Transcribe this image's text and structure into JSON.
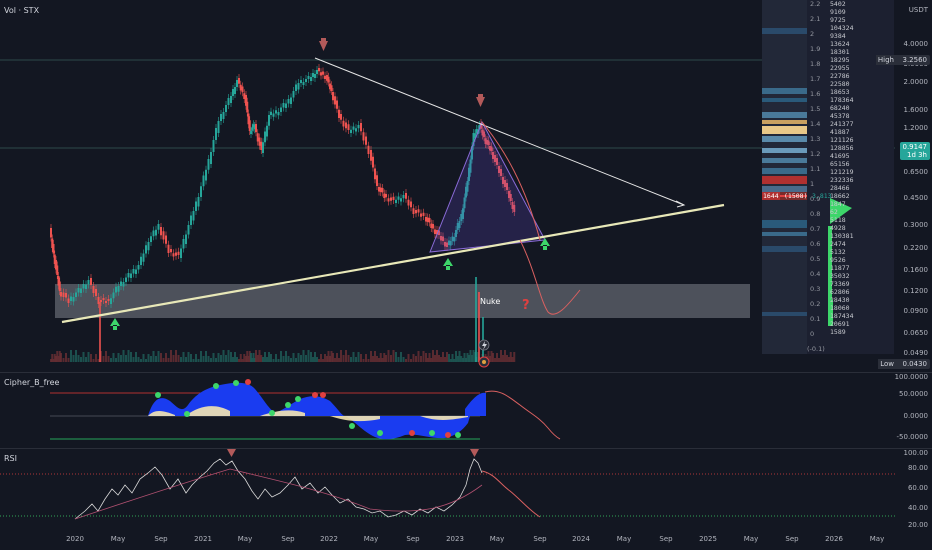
{
  "main_pane": {
    "symbol_label": "Vol · STX",
    "currency": "USDT",
    "price_scale": [
      "4.0000",
      "3.0000",
      "2.0000",
      "1.6000",
      "1.2000",
      "0.6500",
      "0.4500",
      "0.3000",
      "0.2200",
      "0.1600",
      "0.1200",
      "0.0900",
      "0.0650",
      "0.0490"
    ],
    "high_label": "High",
    "high_value": "3.2560",
    "low_label": "Low",
    "low_value": "0.0430",
    "current_price": "0.9147",
    "countdown": "1d 3h",
    "annotation_nuke": "Nuke",
    "annotation_question": "?",
    "lightning_icon": "lightning-icon",
    "vp_label_left": "1644",
    "vp_label_mid": "(1508)",
    "vp_label_right": "3.813"
  },
  "volume_profile": {
    "price_levels": [
      "2.2",
      "2.1",
      "2",
      "1.9",
      "1.8",
      "1.7",
      "1.6",
      "1.5",
      "1.4",
      "1.3",
      "1.2",
      "1.1",
      "1",
      "0.9",
      "0.8",
      "0.7",
      "0.6",
      "0.5",
      "0.4",
      "0.3",
      "0.2",
      "0.1",
      "0",
      "(-0.1)"
    ],
    "volumes": [
      "5402",
      "9109",
      "9725",
      "104324",
      "9384",
      "13624",
      "18301",
      "18295",
      "22955",
      "22786",
      "22580",
      "18653",
      "178364",
      "68240",
      "45378",
      "241377",
      "41887",
      "121126",
      "128856",
      "41695",
      "65156",
      "121219",
      "232336",
      "28466",
      "18662",
      "1847",
      "62",
      "5118",
      "4928",
      "130381",
      "2474",
      "5132",
      "9526",
      "11877",
      "35032",
      "73369",
      "62806",
      "28430",
      "18060",
      "187434",
      "20691",
      "1589"
    ]
  },
  "cipher_pane": {
    "title": "Cipher_B_free",
    "scale": [
      "100.0000",
      "50.0000",
      "0.0000",
      "-50.0000"
    ]
  },
  "rsi_pane": {
    "title": "RSI",
    "scale": [
      "100.00",
      "80.00",
      "60.00",
      "40.00",
      "20.00"
    ]
  },
  "time_axis": [
    "2020",
    "May",
    "Sep",
    "2021",
    "May",
    "Sep",
    "2022",
    "May",
    "Sep",
    "2023",
    "May",
    "Sep",
    "2024",
    "May",
    "Sep",
    "2025",
    "May",
    "Sep",
    "2026",
    "May"
  ],
  "colors": {
    "background": "#131722",
    "up_candle": "#26a69a",
    "down_candle": "#ef5350",
    "trendline": "#d6d7b6",
    "arrow_down": "#b35a5a",
    "arrow_up": "#3dd66a",
    "cipher_blue": "#1a3cf0",
    "rsi_line": "#d9d9d9"
  }
}
